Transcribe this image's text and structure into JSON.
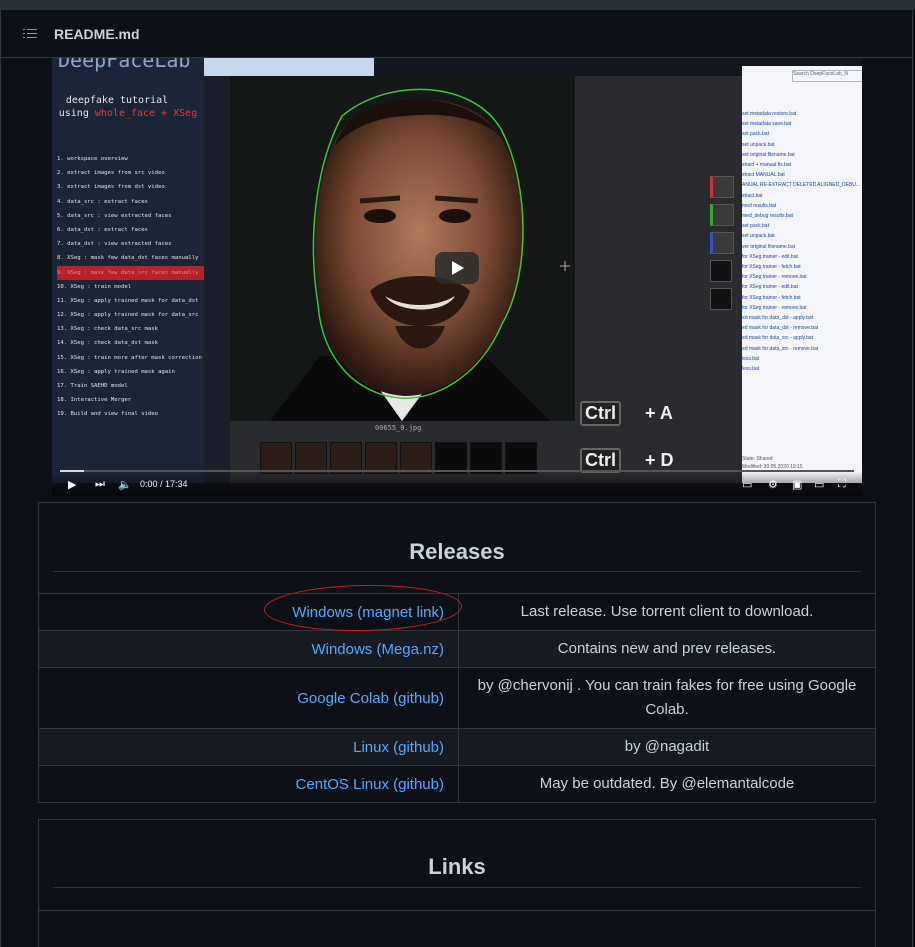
{
  "header": {
    "file_name": "README.md",
    "toc_icon": "list-icon"
  },
  "video": {
    "brand_partial": "DeepFaceLab",
    "tutorial_line1": "deepfake tutorial",
    "tutorial_line2_prefix": "using ",
    "tutorial_line2_highlight": "whole_face + XSeg",
    "steps": [
      "1. workspace overview",
      "2. extract images from src video",
      "3. extract images from dst video",
      "4. data_src : extract faces",
      "5. data_src : view extracted faces",
      "6. data_dst : extract faces",
      "7. data_dst : view extracted faces",
      "8. XSeg : mask few data_dst faces manually",
      "9. XSeg : mask few data_src faces manually",
      "10. XSeg : train model",
      "11. XSeg : apply trained mask for data_dst",
      "12. XSeg : apply trained mask for data_src",
      "13. XSeg : check data_src mask",
      "14. XSeg : check data_dst mask",
      "15. XSeg : train more after mask correction",
      "16. XSeg : apply trained mask again",
      "17. Train SAEHD model",
      "18. Interactive Merger",
      "19. Build and view final video"
    ],
    "highlighted_step_index": 8,
    "frame_filename": "00655_0.jpg",
    "shortcut_1": {
      "key": "Ctrl",
      "plus": "+ A"
    },
    "shortcut_2": {
      "key": "Ctrl",
      "plus": "+ D"
    },
    "explorer_search": "Search DeepFaceLab_N",
    "explorer_items": [
      "set metadata restore.bat",
      "set metadata save.bat",
      "set pack.bat",
      "set unpack.bat",
      "set original filename.bat",
      "xtract + manual fix.bat",
      "xtract MANUAL.bat",
      "ANUAL RE-EXTRACT DELETED ALIGNED_DEBU...",
      "xtract.bat",
      "med results.bat",
      "med_debug results.bat",
      "set pack.bat",
      "set unpack.bat",
      "ver original filename.bat",
      "for XSeg trainer - edit.bat",
      "for XSeg trainer - fetch.bat",
      "for XSeg trainer - remove.bat",
      "for XSeg trainer - edit.bat",
      "for XSeg trainer - fetch.bat",
      "for XSeg trainer - remove.bat",
      "ed mask for data_dst - apply.bat",
      "ed mask for data_dst - remove.bat",
      "ed mask for data_src - apply.bat",
      "ed mask for data_src - remove.bat",
      "less.bat",
      "less.bat"
    ],
    "explorer_state": "State: Shared",
    "explorer_modified": "Modified: 30.05.2020 19:15",
    "time": "0:00 / 17:34",
    "progress": 0.03,
    "icons": {
      "play": "play-icon",
      "next": "next-icon",
      "volume": "volume-icon",
      "subtitles": "subtitles-icon",
      "settings": "settings-icon",
      "miniplayer": "miniplayer-icon",
      "theater": "theater-icon",
      "fullscreen": "fullscreen-icon"
    }
  },
  "releases": {
    "title": "Releases",
    "rows": [
      {
        "link": "Windows (magnet link)",
        "desc": "Last release. Use torrent client to download."
      },
      {
        "link": "Windows (Mega.nz)",
        "desc": "Contains new and prev releases."
      },
      {
        "link": "Google Colab (github)",
        "desc": "by @chervonij . You can train fakes for free using Google Colab."
      },
      {
        "link": "Linux (github)",
        "desc": "by @nagadit"
      },
      {
        "link": "CentOS Linux (github)",
        "desc": "May be outdated. By @elemantalcode"
      }
    ]
  },
  "links": {
    "title": "Links"
  },
  "colors": {
    "link": "#58a6ff",
    "annotation_circle": "#d11b1b",
    "background": "#0d1117"
  }
}
